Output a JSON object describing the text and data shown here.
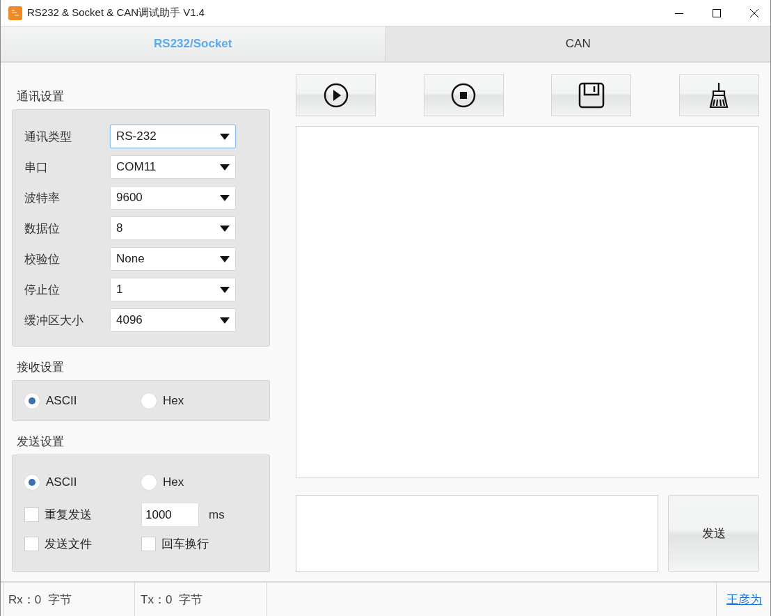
{
  "window": {
    "title": "RS232 & Socket & CAN调试助手 V1.4"
  },
  "tabs": [
    {
      "label": "RS232/Socket",
      "selected": true
    },
    {
      "label": "CAN",
      "selected": false
    }
  ],
  "comm_settings": {
    "title": "通讯设置",
    "fields": [
      {
        "label": "通讯类型",
        "value": "RS-232",
        "focused": true
      },
      {
        "label": "串口",
        "value": "COM11",
        "focused": false
      },
      {
        "label": "波特率",
        "value": "9600",
        "focused": false
      },
      {
        "label": "数据位",
        "value": "8",
        "focused": false
      },
      {
        "label": "校验位",
        "value": "None",
        "focused": false
      },
      {
        "label": "停止位",
        "value": "1",
        "focused": false
      },
      {
        "label": "缓冲区大小",
        "value": "4096",
        "focused": false
      }
    ]
  },
  "receive_settings": {
    "title": "接收设置",
    "options": [
      {
        "label": "ASCII",
        "selected": true
      },
      {
        "label": "Hex",
        "selected": false
      }
    ]
  },
  "send_settings": {
    "title": "发送设置",
    "options": [
      {
        "label": "ASCII",
        "selected": true
      },
      {
        "label": "Hex",
        "selected": false
      }
    ],
    "repeat": {
      "label": "重复发送",
      "checked": false,
      "value": "1000",
      "unit": "ms"
    },
    "send_file": {
      "label": "发送文件",
      "checked": false
    },
    "newline": {
      "label": "回车换行",
      "checked": false
    }
  },
  "send_button": "发送",
  "status_bar": {
    "rx": "Rx：0  字节",
    "tx": "Tx：0  字节",
    "author": "王彦为"
  }
}
